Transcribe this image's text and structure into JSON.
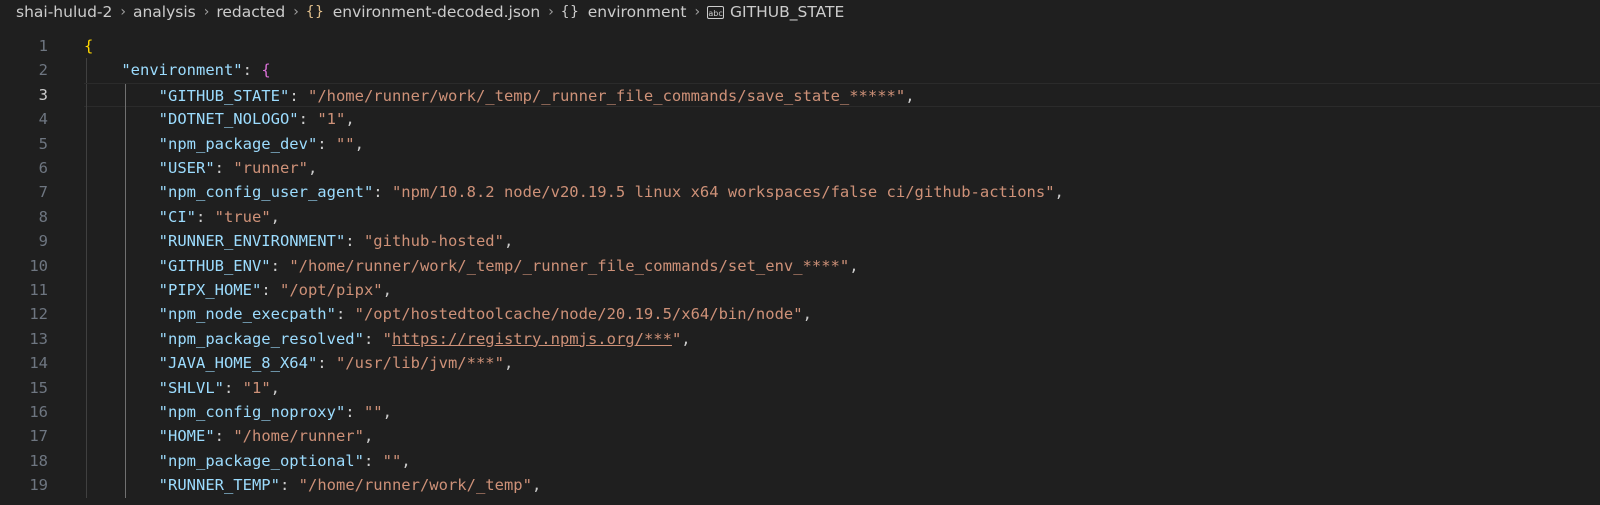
{
  "breadcrumb": {
    "items": [
      {
        "label": "shai-hulud-2",
        "icon": ""
      },
      {
        "label": "analysis",
        "icon": ""
      },
      {
        "label": "redacted",
        "icon": ""
      },
      {
        "label": "environment-decoded.json",
        "icon": "json-braces-icon"
      },
      {
        "label": "environment",
        "icon": "object-braces-icon"
      },
      {
        "label": "GITHUB_STATE",
        "icon": "string-abc-icon"
      }
    ],
    "separator": "›"
  },
  "editor": {
    "current_line": 3,
    "lines": [
      {
        "num": "1",
        "open": "{"
      },
      {
        "num": "2",
        "key": "\"environment\"",
        "open2": "{"
      },
      {
        "num": "3",
        "key": "\"GITHUB_STATE\"",
        "value": "\"/home/runner/work/_temp/_runner_file_commands/save_state_*****\""
      },
      {
        "num": "4",
        "key": "\"DOTNET_NOLOGO\"",
        "value": "\"1\""
      },
      {
        "num": "5",
        "key": "\"npm_package_dev\"",
        "value": "\"\""
      },
      {
        "num": "6",
        "key": "\"USER\"",
        "value": "\"runner\""
      },
      {
        "num": "7",
        "key": "\"npm_config_user_agent\"",
        "value": "\"npm/10.8.2 node/v20.19.5 linux x64 workspaces/false ci/github-actions\""
      },
      {
        "num": "8",
        "key": "\"CI\"",
        "value": "\"true\""
      },
      {
        "num": "9",
        "key": "\"RUNNER_ENVIRONMENT\"",
        "value": "\"github-hosted\""
      },
      {
        "num": "10",
        "key": "\"GITHUB_ENV\"",
        "value": "\"/home/runner/work/_temp/_runner_file_commands/set_env_****\""
      },
      {
        "num": "11",
        "key": "\"PIPX_HOME\"",
        "value": "\"/opt/pipx\""
      },
      {
        "num": "12",
        "key": "\"npm_node_execpath\"",
        "value": "\"/opt/hostedtoolcache/node/20.19.5/x64/bin/node\""
      },
      {
        "num": "13",
        "key": "\"npm_package_resolved\"",
        "value_q1": "\"",
        "url": "https://registry.npmjs.org/***",
        "value_q2": "\""
      },
      {
        "num": "14",
        "key": "\"JAVA_HOME_8_X64\"",
        "value": "\"/usr/lib/jvm/***\""
      },
      {
        "num": "15",
        "key": "\"SHLVL\"",
        "value": "\"1\""
      },
      {
        "num": "16",
        "key": "\"npm_config_noproxy\"",
        "value": "\"\""
      },
      {
        "num": "17",
        "key": "\"HOME\"",
        "value": "\"/home/runner\""
      },
      {
        "num": "18",
        "key": "\"npm_package_optional\"",
        "value": "\"\""
      },
      {
        "num": "19",
        "key": "\"RUNNER_TEMP\"",
        "value": "\"/home/runner/work/_temp\""
      }
    ]
  },
  "colors": {
    "background": "#1f1f1f",
    "key": "#9cdcfe",
    "string": "#ce9178",
    "bracket_outer": "#ffd700",
    "bracket_inner": "#da70d6"
  }
}
